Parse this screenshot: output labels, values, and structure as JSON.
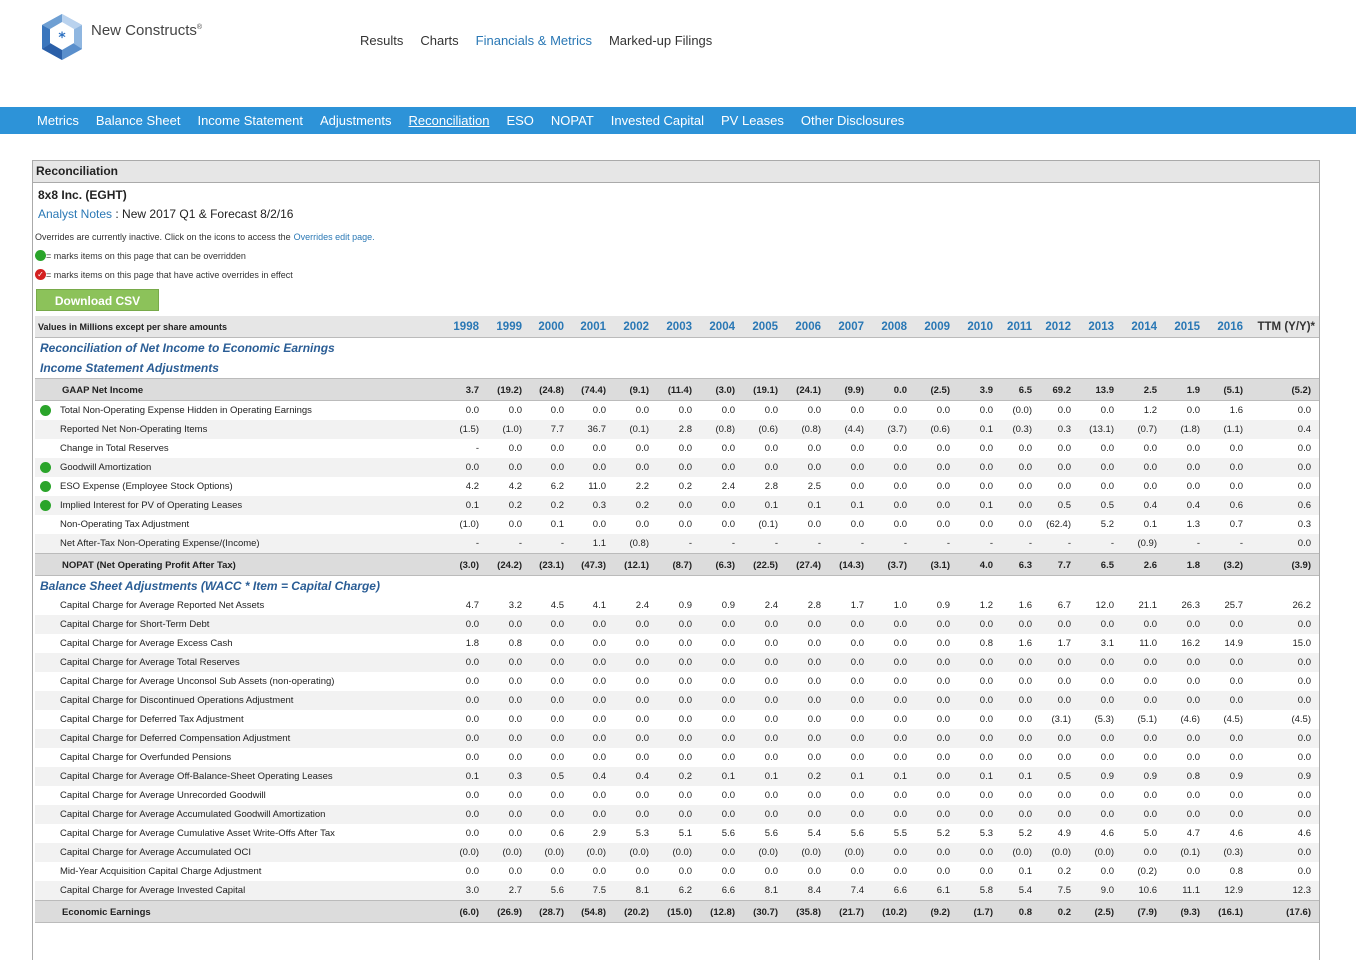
{
  "brand": {
    "name": "New Constructs",
    "mark": "®"
  },
  "top_nav": [
    {
      "label": "Results",
      "active": false
    },
    {
      "label": "Charts",
      "active": false
    },
    {
      "label": "Financials & Metrics",
      "active": true
    },
    {
      "label": "Marked-up Filings",
      "active": false
    }
  ],
  "sub_nav": [
    {
      "label": "Metrics",
      "active": false
    },
    {
      "label": "Balance Sheet",
      "active": false
    },
    {
      "label": "Income Statement",
      "active": false
    },
    {
      "label": "Adjustments",
      "active": false
    },
    {
      "label": "Reconciliation",
      "active": true
    },
    {
      "label": "ESO",
      "active": false
    },
    {
      "label": "NOPAT",
      "active": false
    },
    {
      "label": "Invested Capital",
      "active": false
    },
    {
      "label": "PV Leases",
      "active": false
    },
    {
      "label": "Other Disclosures",
      "active": false
    }
  ],
  "panel": {
    "title": "Reconciliation",
    "company": "8x8 Inc. (EGHT)",
    "notes_link": "Analyst Notes",
    "notes_text": " : New 2017 Q1 & Forecast 8/2/16",
    "overrides_text": "Overrides are currently inactive. Click on the icons to access the",
    "overrides_link": "Overrides edit page.",
    "legend_override": "= marks items on this page that can be overridden",
    "legend_active": "= marks items on this page that have active overrides in effect",
    "csv_button": "Download CSV"
  },
  "table": {
    "header_label": "Values in Millions except per share amounts",
    "columns": [
      "1998",
      "1999",
      "2000",
      "2001",
      "2002",
      "2003",
      "2004",
      "2005",
      "2006",
      "2007",
      "2008",
      "2009",
      "2010",
      "2011",
      "2012",
      "2013",
      "2014",
      "2015",
      "2016",
      "TTM (Y/Y)*"
    ],
    "rows": [
      {
        "type": "sect",
        "label": "Reconciliation of Net Income to Economic Earnings"
      },
      {
        "type": "sect",
        "label": "Income Statement Adjustments"
      },
      {
        "type": "total",
        "label": "GAAP Net Income",
        "values": [
          "3.7",
          "(19.2)",
          "(24.8)",
          "(74.4)",
          "(9.1)",
          "(11.4)",
          "(3.0)",
          "(19.1)",
          "(24.1)",
          "(9.9)",
          "0.0",
          "(2.5)",
          "3.9",
          "6.5",
          "69.2",
          "13.9",
          "2.5",
          "1.9",
          "(5.1)",
          "(5.2)"
        ]
      },
      {
        "type": "item",
        "dot": true,
        "label": "Total Non-Operating Expense Hidden in Operating Earnings",
        "values": [
          "0.0",
          "0.0",
          "0.0",
          "0.0",
          "0.0",
          "0.0",
          "0.0",
          "0.0",
          "0.0",
          "0.0",
          "0.0",
          "0.0",
          "0.0",
          "(0.0)",
          "0.0",
          "0.0",
          "1.2",
          "0.0",
          "1.6",
          "0.0"
        ]
      },
      {
        "type": "item",
        "label": "Reported Net Non-Operating Items",
        "values": [
          "(1.5)",
          "(1.0)",
          "7.7",
          "36.7",
          "(0.1)",
          "2.8",
          "(0.8)",
          "(0.6)",
          "(0.8)",
          "(4.4)",
          "(3.7)",
          "(0.6)",
          "0.1",
          "(0.3)",
          "0.3",
          "(13.1)",
          "(0.7)",
          "(1.8)",
          "(1.1)",
          "0.4"
        ]
      },
      {
        "type": "item",
        "label": "Change in Total Reserves",
        "values": [
          "-",
          "0.0",
          "0.0",
          "0.0",
          "0.0",
          "0.0",
          "0.0",
          "0.0",
          "0.0",
          "0.0",
          "0.0",
          "0.0",
          "0.0",
          "0.0",
          "0.0",
          "0.0",
          "0.0",
          "0.0",
          "0.0",
          "0.0"
        ]
      },
      {
        "type": "item",
        "dot": true,
        "label": "Goodwill Amortization",
        "values": [
          "0.0",
          "0.0",
          "0.0",
          "0.0",
          "0.0",
          "0.0",
          "0.0",
          "0.0",
          "0.0",
          "0.0",
          "0.0",
          "0.0",
          "0.0",
          "0.0",
          "0.0",
          "0.0",
          "0.0",
          "0.0",
          "0.0",
          "0.0"
        ]
      },
      {
        "type": "item",
        "dot": true,
        "label": "ESO Expense (Employee Stock Options)",
        "values": [
          "4.2",
          "4.2",
          "6.2",
          "11.0",
          "2.2",
          "0.2",
          "2.4",
          "2.8",
          "2.5",
          "0.0",
          "0.0",
          "0.0",
          "0.0",
          "0.0",
          "0.0",
          "0.0",
          "0.0",
          "0.0",
          "0.0",
          "0.0"
        ]
      },
      {
        "type": "item",
        "dot": true,
        "label": "Implied Interest for PV of Operating Leases",
        "values": [
          "0.1",
          "0.2",
          "0.2",
          "0.3",
          "0.2",
          "0.0",
          "0.0",
          "0.1",
          "0.1",
          "0.1",
          "0.0",
          "0.0",
          "0.1",
          "0.0",
          "0.5",
          "0.5",
          "0.4",
          "0.4",
          "0.6",
          "0.6"
        ]
      },
      {
        "type": "item",
        "label": "Non-Operating Tax Adjustment",
        "values": [
          "(1.0)",
          "0.0",
          "0.1",
          "0.0",
          "0.0",
          "0.0",
          "0.0",
          "(0.1)",
          "0.0",
          "0.0",
          "0.0",
          "0.0",
          "0.0",
          "0.0",
          "(62.4)",
          "5.2",
          "0.1",
          "1.3",
          "0.7",
          "0.3"
        ]
      },
      {
        "type": "item",
        "label": "Net After-Tax Non-Operating Expense/(Income)",
        "values": [
          "-",
          "-",
          "-",
          "1.1",
          "(0.8)",
          "-",
          "-",
          "-",
          "-",
          "-",
          "-",
          "-",
          "-",
          "-",
          "-",
          "-",
          "(0.9)",
          "-",
          "-",
          "0.0"
        ]
      },
      {
        "type": "total",
        "label": "NOPAT (Net Operating Profit After Tax)",
        "values": [
          "(3.0)",
          "(24.2)",
          "(23.1)",
          "(47.3)",
          "(12.1)",
          "(8.7)",
          "(6.3)",
          "(22.5)",
          "(27.4)",
          "(14.3)",
          "(3.7)",
          "(3.1)",
          "4.0",
          "6.3",
          "7.7",
          "6.5",
          "2.6",
          "1.8",
          "(3.2)",
          "(3.9)"
        ]
      },
      {
        "type": "sect",
        "label": "Balance Sheet Adjustments (WACC * Item = Capital Charge)"
      },
      {
        "type": "item",
        "label": "Capital Charge for Average Reported Net Assets",
        "values": [
          "4.7",
          "3.2",
          "4.5",
          "4.1",
          "2.4",
          "0.9",
          "0.9",
          "2.4",
          "2.8",
          "1.7",
          "1.0",
          "0.9",
          "1.2",
          "1.6",
          "6.7",
          "12.0",
          "21.1",
          "26.3",
          "25.7",
          "26.2"
        ]
      },
      {
        "type": "item",
        "label": "Capital Charge for Short-Term Debt",
        "values": [
          "0.0",
          "0.0",
          "0.0",
          "0.0",
          "0.0",
          "0.0",
          "0.0",
          "0.0",
          "0.0",
          "0.0",
          "0.0",
          "0.0",
          "0.0",
          "0.0",
          "0.0",
          "0.0",
          "0.0",
          "0.0",
          "0.0",
          "0.0"
        ]
      },
      {
        "type": "item",
        "label": "Capital Charge for Average Excess Cash",
        "values": [
          "1.8",
          "0.8",
          "0.0",
          "0.0",
          "0.0",
          "0.0",
          "0.0",
          "0.0",
          "0.0",
          "0.0",
          "0.0",
          "0.0",
          "0.8",
          "1.6",
          "1.7",
          "3.1",
          "11.0",
          "16.2",
          "14.9",
          "15.0"
        ]
      },
      {
        "type": "item",
        "label": "Capital Charge for Average Total Reserves",
        "values": [
          "0.0",
          "0.0",
          "0.0",
          "0.0",
          "0.0",
          "0.0",
          "0.0",
          "0.0",
          "0.0",
          "0.0",
          "0.0",
          "0.0",
          "0.0",
          "0.0",
          "0.0",
          "0.0",
          "0.0",
          "0.0",
          "0.0",
          "0.0"
        ]
      },
      {
        "type": "item",
        "label": "Capital Charge for Average Unconsol Sub Assets (non-operating)",
        "values": [
          "0.0",
          "0.0",
          "0.0",
          "0.0",
          "0.0",
          "0.0",
          "0.0",
          "0.0",
          "0.0",
          "0.0",
          "0.0",
          "0.0",
          "0.0",
          "0.0",
          "0.0",
          "0.0",
          "0.0",
          "0.0",
          "0.0",
          "0.0"
        ]
      },
      {
        "type": "item",
        "label": "Capital Charge for Discontinued Operations Adjustment",
        "values": [
          "0.0",
          "0.0",
          "0.0",
          "0.0",
          "0.0",
          "0.0",
          "0.0",
          "0.0",
          "0.0",
          "0.0",
          "0.0",
          "0.0",
          "0.0",
          "0.0",
          "0.0",
          "0.0",
          "0.0",
          "0.0",
          "0.0",
          "0.0"
        ]
      },
      {
        "type": "item",
        "label": "Capital Charge for Deferred Tax Adjustment",
        "values": [
          "0.0",
          "0.0",
          "0.0",
          "0.0",
          "0.0",
          "0.0",
          "0.0",
          "0.0",
          "0.0",
          "0.0",
          "0.0",
          "0.0",
          "0.0",
          "0.0",
          "(3.1)",
          "(5.3)",
          "(5.1)",
          "(4.6)",
          "(4.5)",
          "(4.5)"
        ]
      },
      {
        "type": "item",
        "label": "Capital Charge for Deferred Compensation Adjustment",
        "values": [
          "0.0",
          "0.0",
          "0.0",
          "0.0",
          "0.0",
          "0.0",
          "0.0",
          "0.0",
          "0.0",
          "0.0",
          "0.0",
          "0.0",
          "0.0",
          "0.0",
          "0.0",
          "0.0",
          "0.0",
          "0.0",
          "0.0",
          "0.0"
        ]
      },
      {
        "type": "item",
        "label": "Capital Charge for Overfunded Pensions",
        "values": [
          "0.0",
          "0.0",
          "0.0",
          "0.0",
          "0.0",
          "0.0",
          "0.0",
          "0.0",
          "0.0",
          "0.0",
          "0.0",
          "0.0",
          "0.0",
          "0.0",
          "0.0",
          "0.0",
          "0.0",
          "0.0",
          "0.0",
          "0.0"
        ]
      },
      {
        "type": "item",
        "label": "Capital Charge for Average Off-Balance-Sheet Operating Leases",
        "values": [
          "0.1",
          "0.3",
          "0.5",
          "0.4",
          "0.4",
          "0.2",
          "0.1",
          "0.1",
          "0.2",
          "0.1",
          "0.1",
          "0.0",
          "0.1",
          "0.1",
          "0.5",
          "0.9",
          "0.9",
          "0.8",
          "0.9",
          "0.9"
        ]
      },
      {
        "type": "item",
        "label": "Capital Charge for Average Unrecorded Goodwill",
        "values": [
          "0.0",
          "0.0",
          "0.0",
          "0.0",
          "0.0",
          "0.0",
          "0.0",
          "0.0",
          "0.0",
          "0.0",
          "0.0",
          "0.0",
          "0.0",
          "0.0",
          "0.0",
          "0.0",
          "0.0",
          "0.0",
          "0.0",
          "0.0"
        ]
      },
      {
        "type": "item",
        "label": "Capital Charge for Average Accumulated Goodwill Amortization",
        "values": [
          "0.0",
          "0.0",
          "0.0",
          "0.0",
          "0.0",
          "0.0",
          "0.0",
          "0.0",
          "0.0",
          "0.0",
          "0.0",
          "0.0",
          "0.0",
          "0.0",
          "0.0",
          "0.0",
          "0.0",
          "0.0",
          "0.0",
          "0.0"
        ]
      },
      {
        "type": "item",
        "label": "Capital Charge for Average Cumulative Asset Write-Offs After Tax",
        "values": [
          "0.0",
          "0.0",
          "0.6",
          "2.9",
          "5.3",
          "5.1",
          "5.6",
          "5.6",
          "5.4",
          "5.6",
          "5.5",
          "5.2",
          "5.3",
          "5.2",
          "4.9",
          "4.6",
          "5.0",
          "4.7",
          "4.6",
          "4.6"
        ]
      },
      {
        "type": "item",
        "label": "Capital Charge for Average Accumulated OCI",
        "values": [
          "(0.0)",
          "(0.0)",
          "(0.0)",
          "(0.0)",
          "(0.0)",
          "(0.0)",
          "0.0",
          "(0.0)",
          "(0.0)",
          "(0.0)",
          "0.0",
          "0.0",
          "0.0",
          "(0.0)",
          "(0.0)",
          "(0.0)",
          "0.0",
          "(0.1)",
          "(0.3)",
          "0.0"
        ]
      },
      {
        "type": "item",
        "label": "Mid-Year Acquisition Capital Charge Adjustment",
        "values": [
          "0.0",
          "0.0",
          "0.0",
          "0.0",
          "0.0",
          "0.0",
          "0.0",
          "0.0",
          "0.0",
          "0.0",
          "0.0",
          "0.0",
          "0.0",
          "0.1",
          "0.2",
          "0.0",
          "(0.2)",
          "0.0",
          "0.8",
          "0.0"
        ]
      },
      {
        "type": "item",
        "label": "Capital Charge for Average Invested Capital",
        "values": [
          "3.0",
          "2.7",
          "5.6",
          "7.5",
          "8.1",
          "6.2",
          "6.6",
          "8.1",
          "8.4",
          "7.4",
          "6.6",
          "6.1",
          "5.8",
          "5.4",
          "7.5",
          "9.0",
          "10.6",
          "11.1",
          "12.9",
          "12.3"
        ]
      },
      {
        "type": "total",
        "label": "Economic Earnings",
        "values": [
          "(6.0)",
          "(26.9)",
          "(28.7)",
          "(54.8)",
          "(20.2)",
          "(15.0)",
          "(12.8)",
          "(30.7)",
          "(35.8)",
          "(21.7)",
          "(10.2)",
          "(9.2)",
          "(1.7)",
          "0.8",
          "0.2",
          "(2.5)",
          "(7.9)",
          "(9.3)",
          "(16.1)",
          "(17.6)"
        ]
      }
    ]
  }
}
